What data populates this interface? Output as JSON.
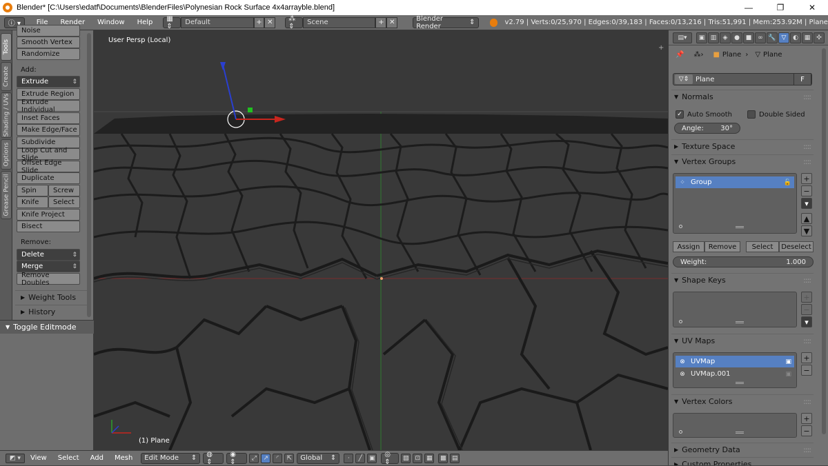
{
  "window": {
    "title": "Blender* [C:\\Users\\edatf\\Documents\\BlenderFiles\\Polynesian Rock Surface 4x4arrayble.blend]",
    "minimize": "—",
    "maximize": "❐",
    "close": "✕"
  },
  "topbar": {
    "menus": [
      "File",
      "Render",
      "Window",
      "Help"
    ],
    "layout": "Default",
    "scene": "Scene",
    "engine": "Blender Render",
    "stats": "v2.79 | Verts:0/25,970 | Edges:0/39,183 | Faces:0/13,216 | Tris:51,991 | Mem:253.92M | Plane"
  },
  "tool_tabs": [
    "Tools",
    "Create",
    "Shading / UVs",
    "Options",
    "Grease Pencil"
  ],
  "tool_panel": {
    "partial_top": "Noise",
    "buttons_top": [
      "Smooth Vertex",
      "Randomize"
    ],
    "add_label": "Add:",
    "extrude": "Extrude",
    "add_buttons": [
      "Extrude Region",
      "Extrude Individual",
      "Inset Faces",
      "Make Edge/Face",
      "Subdivide",
      "Loop Cut and Slide",
      "Offset Edge Slide",
      "Duplicate"
    ],
    "spin": "Spin",
    "screw": "Screw",
    "knife": "Knife",
    "select": "Select",
    "knife_project": "Knife Project",
    "bisect": "Bisect",
    "remove_label": "Remove:",
    "delete": "Delete",
    "merge": "Merge",
    "remove_doubles": "Remove Doubles",
    "weight_tools": "Weight Tools",
    "history": "History",
    "toggle_editmode": "Toggle Editmode"
  },
  "viewport": {
    "view_label": "User Persp (Local)",
    "object_label": "(1) Plane"
  },
  "bottombar": {
    "menus": [
      "View",
      "Select",
      "Add",
      "Mesh"
    ],
    "mode": "Edit Mode",
    "orientation": "Global"
  },
  "properties": {
    "breadcrumb": [
      "Plane",
      "Plane"
    ],
    "mesh_name": "Plane",
    "fake_user": "F",
    "normals": {
      "header": "Normals",
      "auto_smooth": "Auto Smooth",
      "double_sided": "Double Sided",
      "angle": "Angle:",
      "angle_value": "30°"
    },
    "texture_space": "Texture Space",
    "vertex_groups": {
      "header": "Vertex Groups",
      "items": [
        "Group"
      ],
      "assign": "Assign",
      "remove": "Remove",
      "select": "Select",
      "deselect": "Deselect",
      "weight_label": "Weight:",
      "weight_value": "1.000"
    },
    "shape_keys": "Shape Keys",
    "uv_maps": {
      "header": "UV Maps",
      "items": [
        "UVMap",
        "UVMap.001"
      ]
    },
    "vertex_colors": "Vertex Colors",
    "geometry_data": "Geometry Data",
    "custom_properties": "Custom Properties"
  },
  "colors": {
    "accent_blue": "#5680c2",
    "panel_gray": "#737373",
    "viewport_bg": "#393939"
  }
}
